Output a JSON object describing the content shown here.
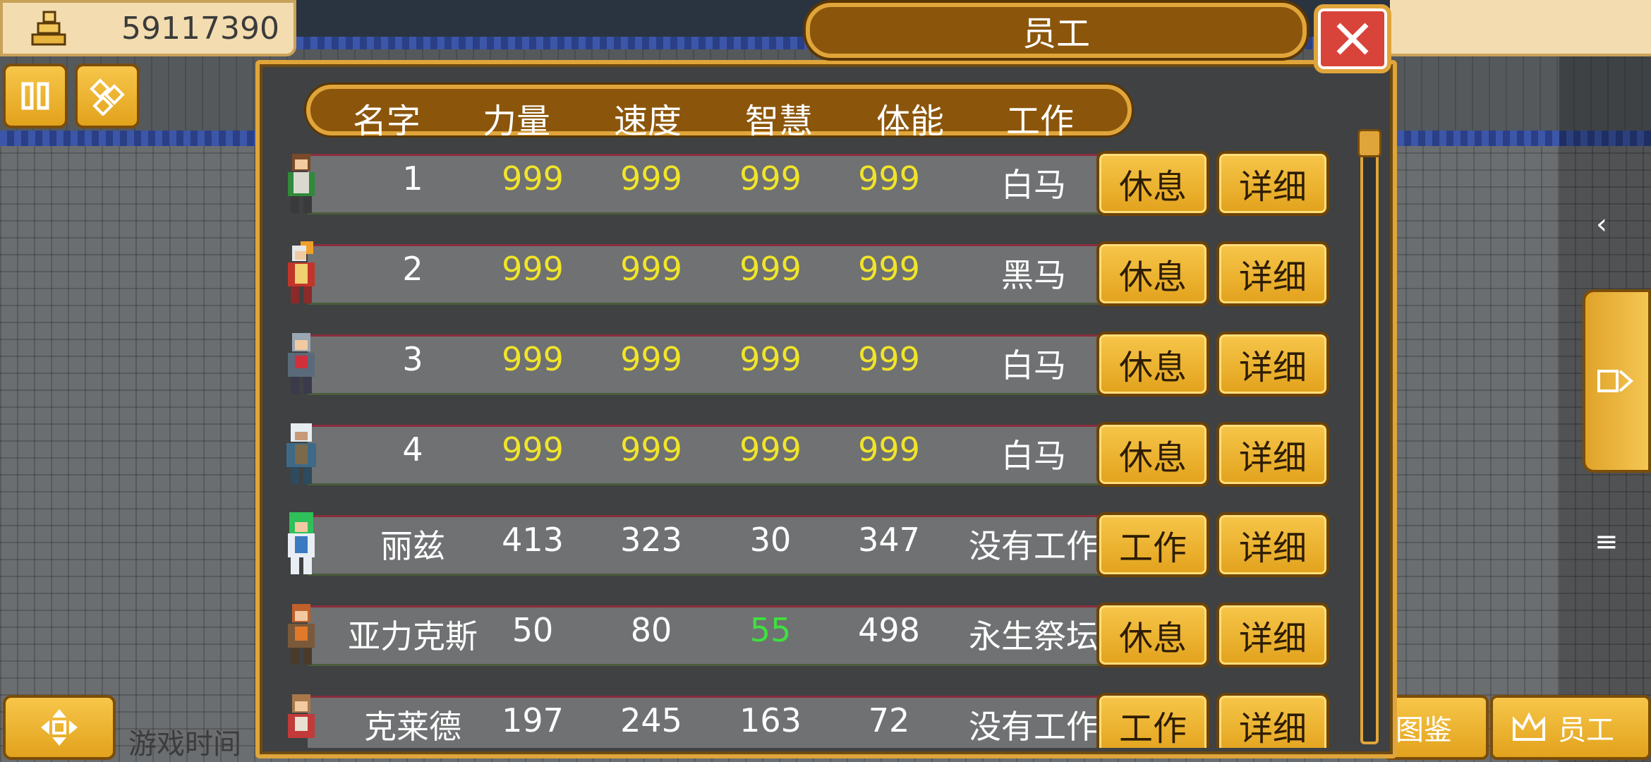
{
  "hud": {
    "money": "59117390",
    "game_time_label": "游戏时间",
    "bottom_tabs": {
      "atlas": "图鉴",
      "staff": "员工"
    }
  },
  "panel": {
    "title": "员工",
    "headers": [
      "名字",
      "力量",
      "速度",
      "智慧",
      "体能",
      "工作"
    ]
  },
  "employees": [
    {
      "name": "1",
      "strength": "999",
      "speed": "999",
      "wisdom": "999",
      "stamina": "999",
      "job": "白马",
      "action": "休息",
      "detail": "详细"
    },
    {
      "name": "2",
      "strength": "999",
      "speed": "999",
      "wisdom": "999",
      "stamina": "999",
      "job": "黑马",
      "action": "休息",
      "detail": "详细"
    },
    {
      "name": "3",
      "strength": "999",
      "speed": "999",
      "wisdom": "999",
      "stamina": "999",
      "job": "白马",
      "action": "休息",
      "detail": "详细"
    },
    {
      "name": "4",
      "strength": "999",
      "speed": "999",
      "wisdom": "999",
      "stamina": "999",
      "job": "白马",
      "action": "休息",
      "detail": "详细"
    },
    {
      "name": "丽兹",
      "strength": "413",
      "speed": "323",
      "wisdom": "30",
      "stamina": "347",
      "job": "没有工作",
      "action": "工作",
      "detail": "详细"
    },
    {
      "name": "亚力克斯",
      "strength": "50",
      "speed": "80",
      "wisdom": "55",
      "stamina": "498",
      "job": "永生祭坛",
      "action": "休息",
      "detail": "详细"
    },
    {
      "name": "克莱德",
      "strength": "197",
      "speed": "245",
      "wisdom": "163",
      "stamina": "72",
      "job": "没有工作",
      "action": "工作",
      "detail": "详细"
    }
  ],
  "colors": {
    "gold": "#e0a53a",
    "brown": "#8b560b",
    "stat_max": "#f0e42a",
    "stat_buff": "#3fe03f",
    "close_red": "#d9443a"
  },
  "icons": [
    "coins-icon",
    "pause-icon",
    "gems-icon",
    "dpad-icon",
    "close-icon",
    "crown-icon",
    "chevron-left-icon",
    "menu-icon",
    "panel-toggle-icon"
  ]
}
